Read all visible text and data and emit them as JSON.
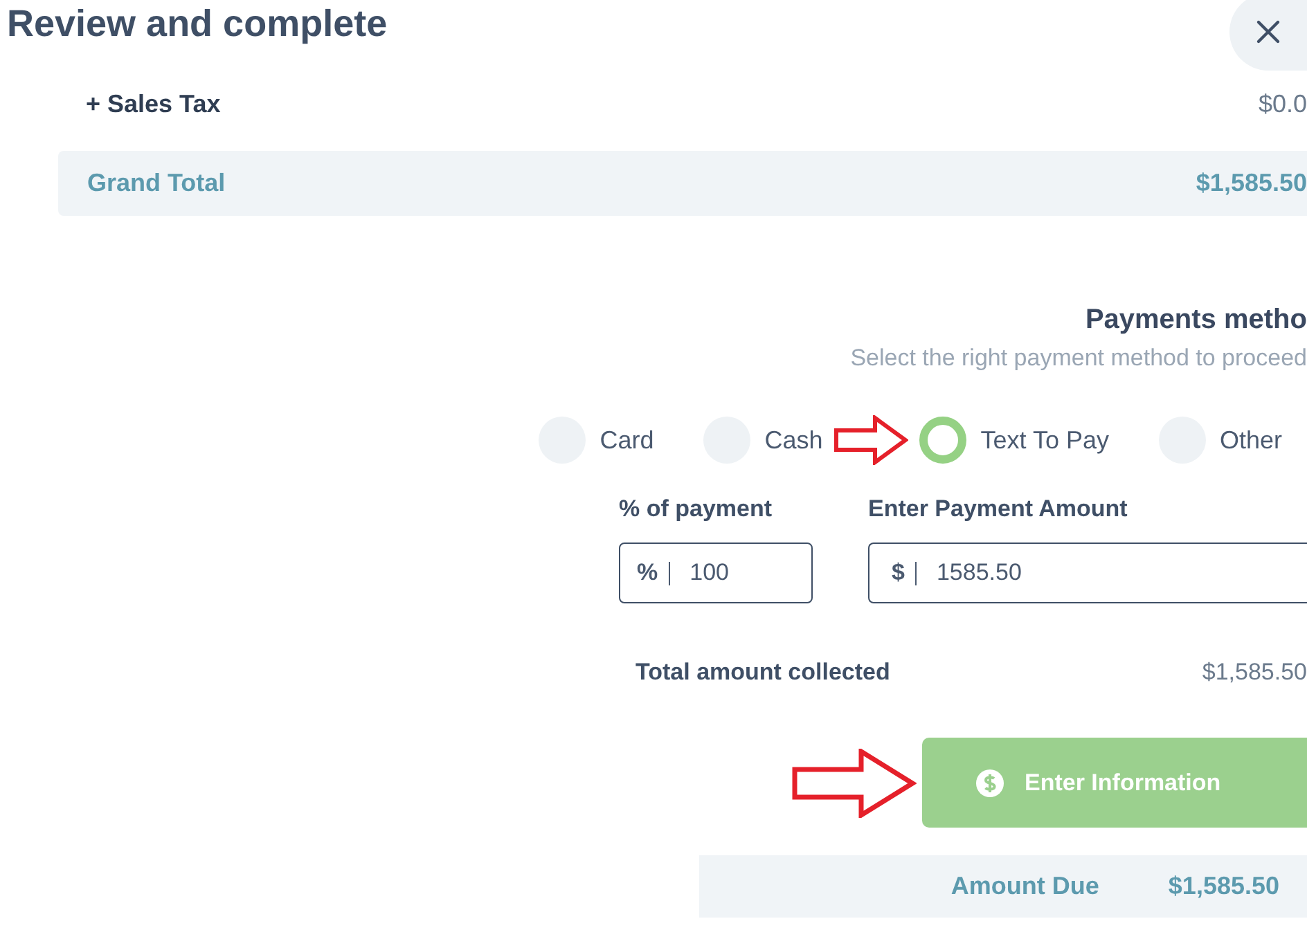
{
  "title": "Review and complete",
  "summary": {
    "sales_tax": {
      "label": "+ Sales Tax",
      "value": "$0.0"
    },
    "grand_total": {
      "label": "Grand Total",
      "value": "$1,585.50"
    }
  },
  "payment": {
    "heading": "Payments metho",
    "subtitle": "Select the right payment method to proceed",
    "methods": [
      {
        "label": "Card",
        "selected": false
      },
      {
        "label": "Cash",
        "selected": false
      },
      {
        "label": "Text To Pay",
        "selected": true
      },
      {
        "label": "Other",
        "selected": false
      }
    ],
    "percent_field": {
      "label": "% of payment",
      "prefix": "%",
      "value": "100"
    },
    "amount_field": {
      "label": "Enter Payment Amount",
      "prefix": "$",
      "value": "1585.50"
    },
    "total_collected": {
      "label": "Total amount collected",
      "value": "$1,585.50"
    },
    "enter_button": {
      "label": "Enter Information"
    },
    "amount_due": {
      "label": "Amount Due",
      "value": "$1,585.50"
    }
  }
}
